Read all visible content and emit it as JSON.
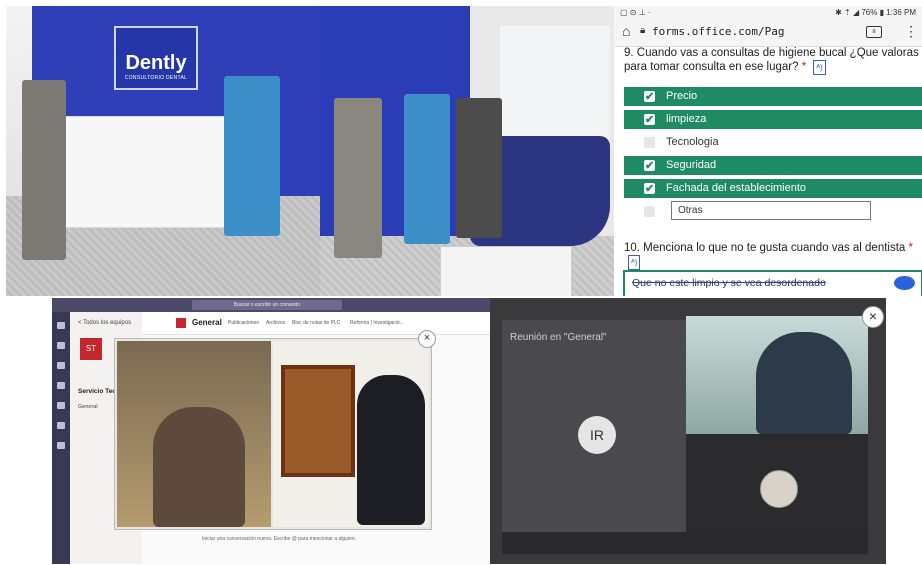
{
  "photo1": {
    "logo_brand": "Dently",
    "logo_sub": "CONSULTORIO DENTAL"
  },
  "form": {
    "status_left": "▢ ⊙ ⊥ ·",
    "status_right": "✱ ⇡ ◢ 76% ▮ 1:36 PM",
    "url": "forms.office.com/Pag",
    "q9": "9. Cuando vas a consultas de higiene bucal ¿Que valoras para tomar consulta en ese lugar?",
    "options": [
      {
        "label": "Precio",
        "checked": true
      },
      {
        "label": "limpieza",
        "checked": true
      },
      {
        "label": "Tecnologia",
        "checked": false
      },
      {
        "label": "Seguridad",
        "checked": true
      },
      {
        "label": "Fachada del establecimiento",
        "checked": true
      },
      {
        "label": "Otras",
        "checked": false
      }
    ],
    "q10": "10. Menciona lo que no te gusta cuando vas al dentista",
    "answer": "Que no este limpio y se vea desordenado",
    "tts_label": "ᴬ)",
    "accent": "#1e8b65"
  },
  "teams_left": {
    "search_placeholder": "Buscar o escribir un comando",
    "back_label": "< Todos los equipos",
    "team_initials": "ST",
    "team_name": "Servicio Tec",
    "channel_item": "General",
    "channel_name": "General",
    "tabs": [
      "Publicaciones",
      "Archivos",
      "Bloc de notas de PLC",
      "Reforma | Investigació..."
    ],
    "compose_placeholder": "Iniciar una conversación nueva. Escribe @ para mencionar a alguien.",
    "close_glyph": "×"
  },
  "teams_right": {
    "meeting_title": "Reunión en \"General\"",
    "avatar_initials": "IR",
    "close_glyph": "×"
  }
}
